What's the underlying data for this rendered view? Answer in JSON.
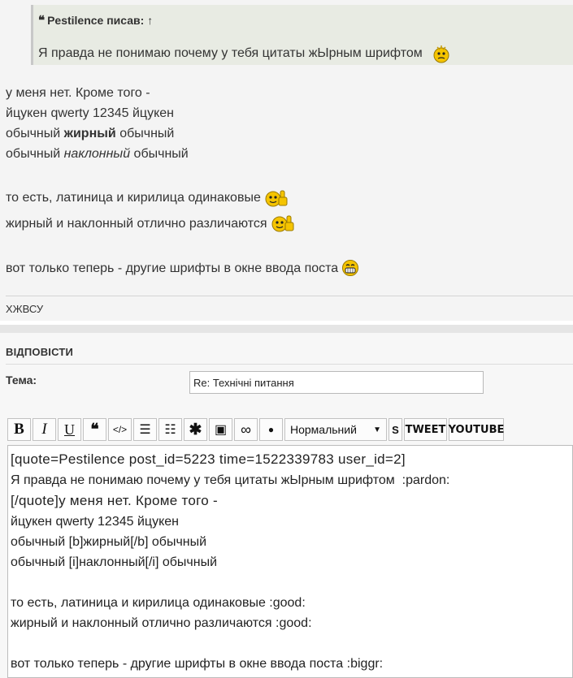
{
  "quote": {
    "header": "Pestilence писав: ↑",
    "text": "Я правда не понимаю почему у тебя цитаты жЫрным шрифтом"
  },
  "post": {
    "line1": "у меня нет. Кроме того -",
    "line2": "йцукен qwerty 12345 йцукен",
    "line3_a": "обычный ",
    "line3_b": "жирный",
    "line3_c": " обычный",
    "line4_a": "обычный ",
    "line4_b": "наклонный",
    "line4_c": " обычный",
    "line5": "то есть, латиница и кирилица одинаковые",
    "line6": "жирный и наклонный отлично различаются",
    "line7": "вот только теперь - другие шрифты в окне ввода поста",
    "signature": "ХЖВСУ"
  },
  "reply": {
    "title": "Відповісти",
    "subject_label": "Тема:",
    "subject_value": "Re: Технічні питання",
    "toolbar": {
      "bold": "B",
      "italic": "I",
      "underline": "U",
      "quote": "❝",
      "code": "</>",
      "list": "☰",
      "numbered_list": "☷",
      "star": "✱",
      "image": "▣",
      "link": "∞",
      "color": "●",
      "size_select": "Нормальний",
      "size_arrow": "▼",
      "s_button": "S",
      "tweet": "TWEET",
      "youtube": "YOUTUBE"
    },
    "editor_lines": [
      "[quote=Pestilence post_id=5223 time=1522339783 user_id=2]",
      "Я правда не понимаю почему у тебя цитаты жЫрным шрифтом  :pardon:",
      "[/quote]у меня нет. Кроме того -",
      "йцукен qwerty 12345 йцукен",
      "обычный [b]жирный[/b] обычный",
      "обычный [i]наклонный[/i] обычный",
      "",
      "то есть, латиница и кирилица одинаковые :good:",
      "жирный и наклонный отлично различаются :good:",
      "",
      "вот только теперь - другие шрифты в окне ввода поста :biggr:"
    ]
  }
}
